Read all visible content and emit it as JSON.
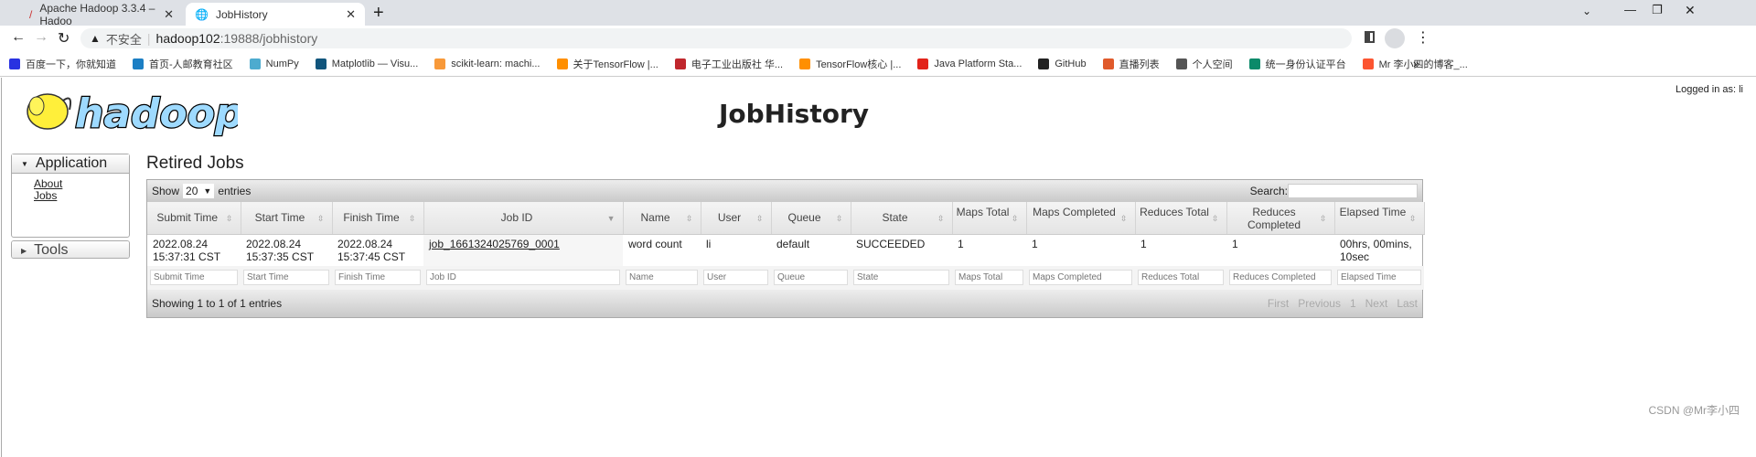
{
  "browser": {
    "tabs": [
      {
        "label": "Apache Hadoop 3.3.4 – Hadoo"
      },
      {
        "label": "JobHistory"
      }
    ],
    "security_label": "不安全",
    "url_host": "hadoop102",
    "url_rest": ":19888/jobhistory",
    "bookmarks": [
      {
        "label": "百度一下，你就知道",
        "color": "#2932e1"
      },
      {
        "label": "首页-人邮教育社区",
        "color": "#1c7fc4"
      },
      {
        "label": "NumPy",
        "color": "#4dabcf"
      },
      {
        "label": "Matplotlib — Visu...",
        "color": "#11557c"
      },
      {
        "label": "scikit-learn: machi...",
        "color": "#f89939"
      },
      {
        "label": "关于TensorFlow |...",
        "color": "#ff8f00"
      },
      {
        "label": "电子工业出版社 华...",
        "color": "#c0272d"
      },
      {
        "label": "TensorFlow核心 |...",
        "color": "#ff8f00"
      },
      {
        "label": "Java Platform Sta...",
        "color": "#e2231a"
      },
      {
        "label": "GitHub",
        "color": "#222222"
      },
      {
        "label": "直播列表",
        "color": "#e05a2b"
      },
      {
        "label": "个人空间",
        "color": "#555555"
      },
      {
        "label": "统一身份认证平台",
        "color": "#0b8a6a"
      },
      {
        "label": "Mr 李小四的博客_...",
        "color": "#fc5531"
      }
    ],
    "more": "»"
  },
  "header": {
    "title": "JobHistory",
    "logged_in": "Logged in as: li",
    "logo_text": "hadoop"
  },
  "sidebar": {
    "application": "Application",
    "links": [
      "About",
      "Jobs"
    ],
    "tools": "Tools"
  },
  "main": {
    "heading": "Retired Jobs",
    "show": "Show",
    "page_size": "20",
    "entries": "entries",
    "search_label": "Search:",
    "columns": [
      "Submit Time",
      "Start Time",
      "Finish Time",
      "Job ID",
      "Name",
      "User",
      "Queue",
      "State",
      "Maps Total",
      "Maps Completed",
      "Reduces Total",
      "Reduces Completed",
      "Elapsed Time"
    ],
    "rows": [
      [
        "2022.08.24 15:37:31 CST",
        "2022.08.24 15:37:35 CST",
        "2022.08.24 15:37:45 CST",
        "job_1661324025769_0001",
        "word count",
        "li",
        "default",
        "SUCCEEDED",
        "1",
        "1",
        "1",
        "1",
        "00hrs, 00mins, 10sec"
      ]
    ],
    "info": "Showing 1 to 1 of 1 entries",
    "pager": [
      "First",
      "Previous",
      "1",
      "Next",
      "Last"
    ]
  },
  "watermark": "CSDN @Mr李小四"
}
